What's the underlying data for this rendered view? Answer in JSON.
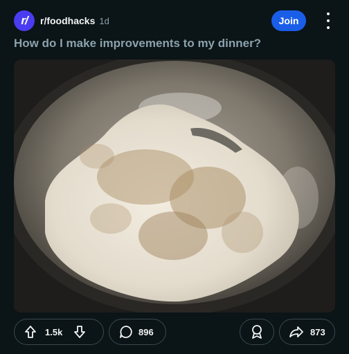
{
  "post": {
    "community": "r/foodhacks",
    "separator": "·",
    "age": "1d",
    "title": "How do I make improvements to my dinner?",
    "join_label": "Join",
    "avatar_letter": "r/"
  },
  "actions": {
    "upvotes": "1.5k",
    "comments": "896",
    "shares": "873"
  },
  "colors": {
    "accent": "#1a5ee8",
    "avatar": "#4a3cf0",
    "background": "#0b1416"
  }
}
